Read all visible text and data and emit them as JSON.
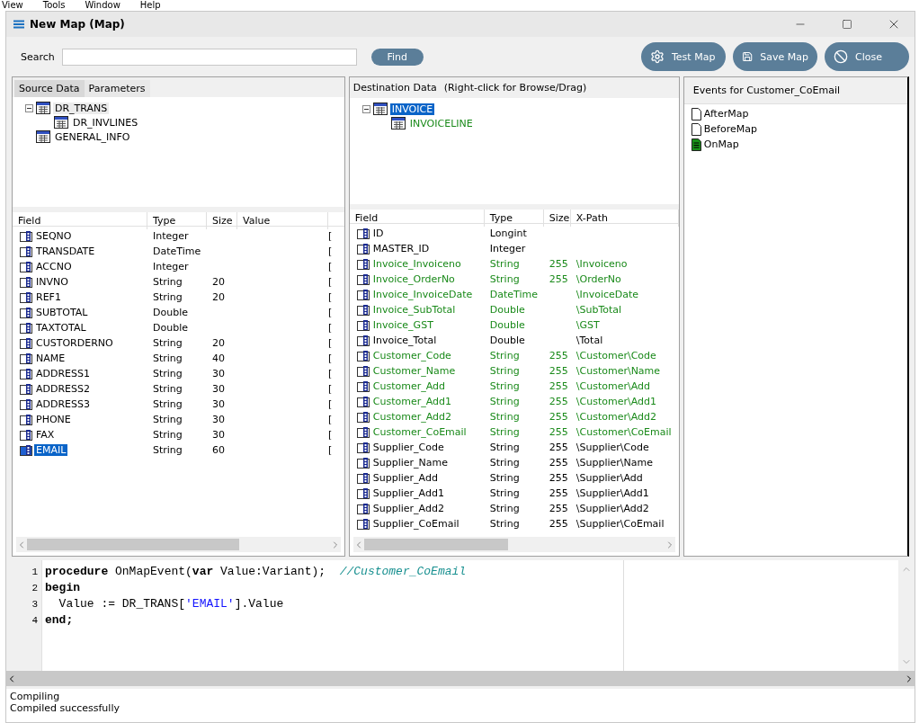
{
  "app_menu": [
    "View",
    "Tools",
    "Window",
    "Help"
  ],
  "window": {
    "title": "New Map (Map)"
  },
  "search": {
    "label": "Search",
    "button": "Find"
  },
  "actions": [
    {
      "label": "Test Map",
      "kind": "test"
    },
    {
      "label": "Save Map",
      "kind": "save"
    },
    {
      "label": "Close",
      "kind": "close"
    }
  ],
  "source": {
    "tabs": [
      {
        "label": "Source Data",
        "selected": true
      },
      {
        "label": "Parameters",
        "selected": false
      }
    ],
    "focused": false,
    "tree": [
      {
        "label": "DR_TRANS",
        "selected": true,
        "mapped": false,
        "expanded": true,
        "children": [
          {
            "label": "DR_INVLINES",
            "selected": false,
            "mapped": false
          }
        ]
      },
      {
        "label": "GENERAL_INFO",
        "selected": false,
        "mapped": false
      }
    ],
    "columns": [
      "Field",
      "Type",
      "Size",
      "Value"
    ],
    "rows": [
      {
        "field": "SEQNO",
        "type": "Integer",
        "size": "",
        "value": "",
        "column_5": "[",
        "selected": false
      },
      {
        "field": "TRANSDATE",
        "type": "DateTime",
        "size": "",
        "value": "",
        "column_5": "[",
        "selected": false
      },
      {
        "field": "ACCNO",
        "type": "Integer",
        "size": "",
        "value": "",
        "column_5": "[",
        "selected": false
      },
      {
        "field": "INVNO",
        "type": "String",
        "size": "20",
        "value": "",
        "column_5": "[",
        "selected": false
      },
      {
        "field": "REF1",
        "type": "String",
        "size": "20",
        "value": "",
        "column_5": "[",
        "selected": false
      },
      {
        "field": "SUBTOTAL",
        "type": "Double",
        "size": "",
        "value": "",
        "column_5": "[",
        "selected": false
      },
      {
        "field": "TAXTOTAL",
        "type": "Double",
        "size": "",
        "value": "",
        "column_5": "[",
        "selected": false
      },
      {
        "field": "CUSTORDERNO",
        "type": "String",
        "size": "20",
        "value": "",
        "column_5": "[",
        "selected": false
      },
      {
        "field": "NAME",
        "type": "String",
        "size": "40",
        "value": "",
        "column_5": "[",
        "selected": false
      },
      {
        "field": "ADDRESS1",
        "type": "String",
        "size": "30",
        "value": "",
        "column_5": "[",
        "selected": false
      },
      {
        "field": "ADDRESS2",
        "type": "String",
        "size": "30",
        "value": "",
        "column_5": "[",
        "selected": false
      },
      {
        "field": "ADDRESS3",
        "type": "String",
        "size": "30",
        "value": "",
        "column_5": "[",
        "selected": false
      },
      {
        "field": "PHONE",
        "type": "String",
        "size": "30",
        "value": "",
        "column_5": "[",
        "selected": false
      },
      {
        "field": "FAX",
        "type": "String",
        "size": "30",
        "value": "",
        "column_5": "[",
        "selected": false
      },
      {
        "field": "EMAIL",
        "type": "String",
        "size": "60",
        "value": "",
        "column_5": "[",
        "selected": true
      }
    ]
  },
  "destination": {
    "title": "Destination Data",
    "hint": "(Right-click for Browse/Drag)",
    "focused": true,
    "tree": [
      {
        "label": "INVOICE",
        "selected": true,
        "mapped": false,
        "expanded": true,
        "children": [
          {
            "label": "INVOICELINE",
            "selected": false,
            "mapped": true
          }
        ]
      }
    ],
    "columns": [
      "Field",
      "Type",
      "Size",
      "X-Path"
    ],
    "rows": [
      {
        "field": "ID",
        "type": "Longint",
        "size": "",
        "xpath": "",
        "mapped": false
      },
      {
        "field": "MASTER_ID",
        "type": "Integer",
        "size": "",
        "xpath": "",
        "mapped": false
      },
      {
        "field": "Invoice_Invoiceno",
        "type": "String",
        "size": "255",
        "xpath": "\\Invoiceno",
        "mapped": true
      },
      {
        "field": "Invoice_OrderNo",
        "type": "String",
        "size": "255",
        "xpath": "\\OrderNo",
        "mapped": true
      },
      {
        "field": "Invoice_InvoiceDate",
        "type": "DateTime",
        "size": "",
        "xpath": "\\InvoiceDate",
        "mapped": true
      },
      {
        "field": "Invoice_SubTotal",
        "type": "Double",
        "size": "",
        "xpath": "\\SubTotal",
        "mapped": true
      },
      {
        "field": "Invoice_GST",
        "type": "Double",
        "size": "",
        "xpath": "\\GST",
        "mapped": true
      },
      {
        "field": "Invoice_Total",
        "type": "Double",
        "size": "",
        "xpath": "\\Total",
        "mapped": false
      },
      {
        "field": "Customer_Code",
        "type": "String",
        "size": "255",
        "xpath": "\\Customer\\Code",
        "mapped": true
      },
      {
        "field": "Customer_Name",
        "type": "String",
        "size": "255",
        "xpath": "\\Customer\\Name",
        "mapped": true
      },
      {
        "field": "Customer_Add",
        "type": "String",
        "size": "255",
        "xpath": "\\Customer\\Add",
        "mapped": true
      },
      {
        "field": "Customer_Add1",
        "type": "String",
        "size": "255",
        "xpath": "\\Customer\\Add1",
        "mapped": true
      },
      {
        "field": "Customer_Add2",
        "type": "String",
        "size": "255",
        "xpath": "\\Customer\\Add2",
        "mapped": true
      },
      {
        "field": "Customer_CoEmail",
        "type": "String",
        "size": "255",
        "xpath": "\\Customer\\CoEmail",
        "mapped": true
      },
      {
        "field": "Supplier_Code",
        "type": "String",
        "size": "255",
        "xpath": "\\Supplier\\Code",
        "mapped": false
      },
      {
        "field": "Supplier_Name",
        "type": "String",
        "size": "255",
        "xpath": "\\Supplier\\Name",
        "mapped": false
      },
      {
        "field": "Supplier_Add",
        "type": "String",
        "size": "255",
        "xpath": "\\Supplier\\Add",
        "mapped": false
      },
      {
        "field": "Supplier_Add1",
        "type": "String",
        "size": "255",
        "xpath": "\\Supplier\\Add1",
        "mapped": false
      },
      {
        "field": "Supplier_Add2",
        "type": "String",
        "size": "255",
        "xpath": "\\Supplier\\Add2",
        "mapped": false
      },
      {
        "field": "Supplier_CoEmail",
        "type": "String",
        "size": "255",
        "xpath": "\\Supplier\\CoEmail",
        "mapped": false
      }
    ]
  },
  "events": {
    "title": "Events for Customer_CoEmail",
    "items": [
      {
        "label": "AfterMap",
        "has_code": false
      },
      {
        "label": "BeforeMap",
        "has_code": false
      },
      {
        "label": "OnMap",
        "has_code": true
      }
    ]
  },
  "code": {
    "lines": [
      {
        "number": "1",
        "tokens": [
          {
            "kind": "keyword",
            "text": "procedure"
          },
          {
            "kind": "plain",
            "text": " OnMapEvent("
          },
          {
            "kind": "keyword",
            "text": "var"
          },
          {
            "kind": "plain",
            "text": " Value:Variant);  "
          },
          {
            "kind": "comment",
            "text": "//Customer_CoEmail"
          }
        ]
      },
      {
        "number": "2",
        "tokens": [
          {
            "kind": "keyword",
            "text": "begin"
          }
        ]
      },
      {
        "number": "3",
        "tokens": [
          {
            "kind": "plain",
            "text": "  Value := DR_TRANS["
          },
          {
            "kind": "string",
            "text": "'EMAIL'"
          },
          {
            "kind": "plain",
            "text": "].Value"
          }
        ]
      },
      {
        "number": "4",
        "tokens": [
          {
            "kind": "keyword",
            "text": "end;"
          }
        ]
      }
    ]
  },
  "output": [
    "Compiling",
    "Compiled successfully"
  ]
}
